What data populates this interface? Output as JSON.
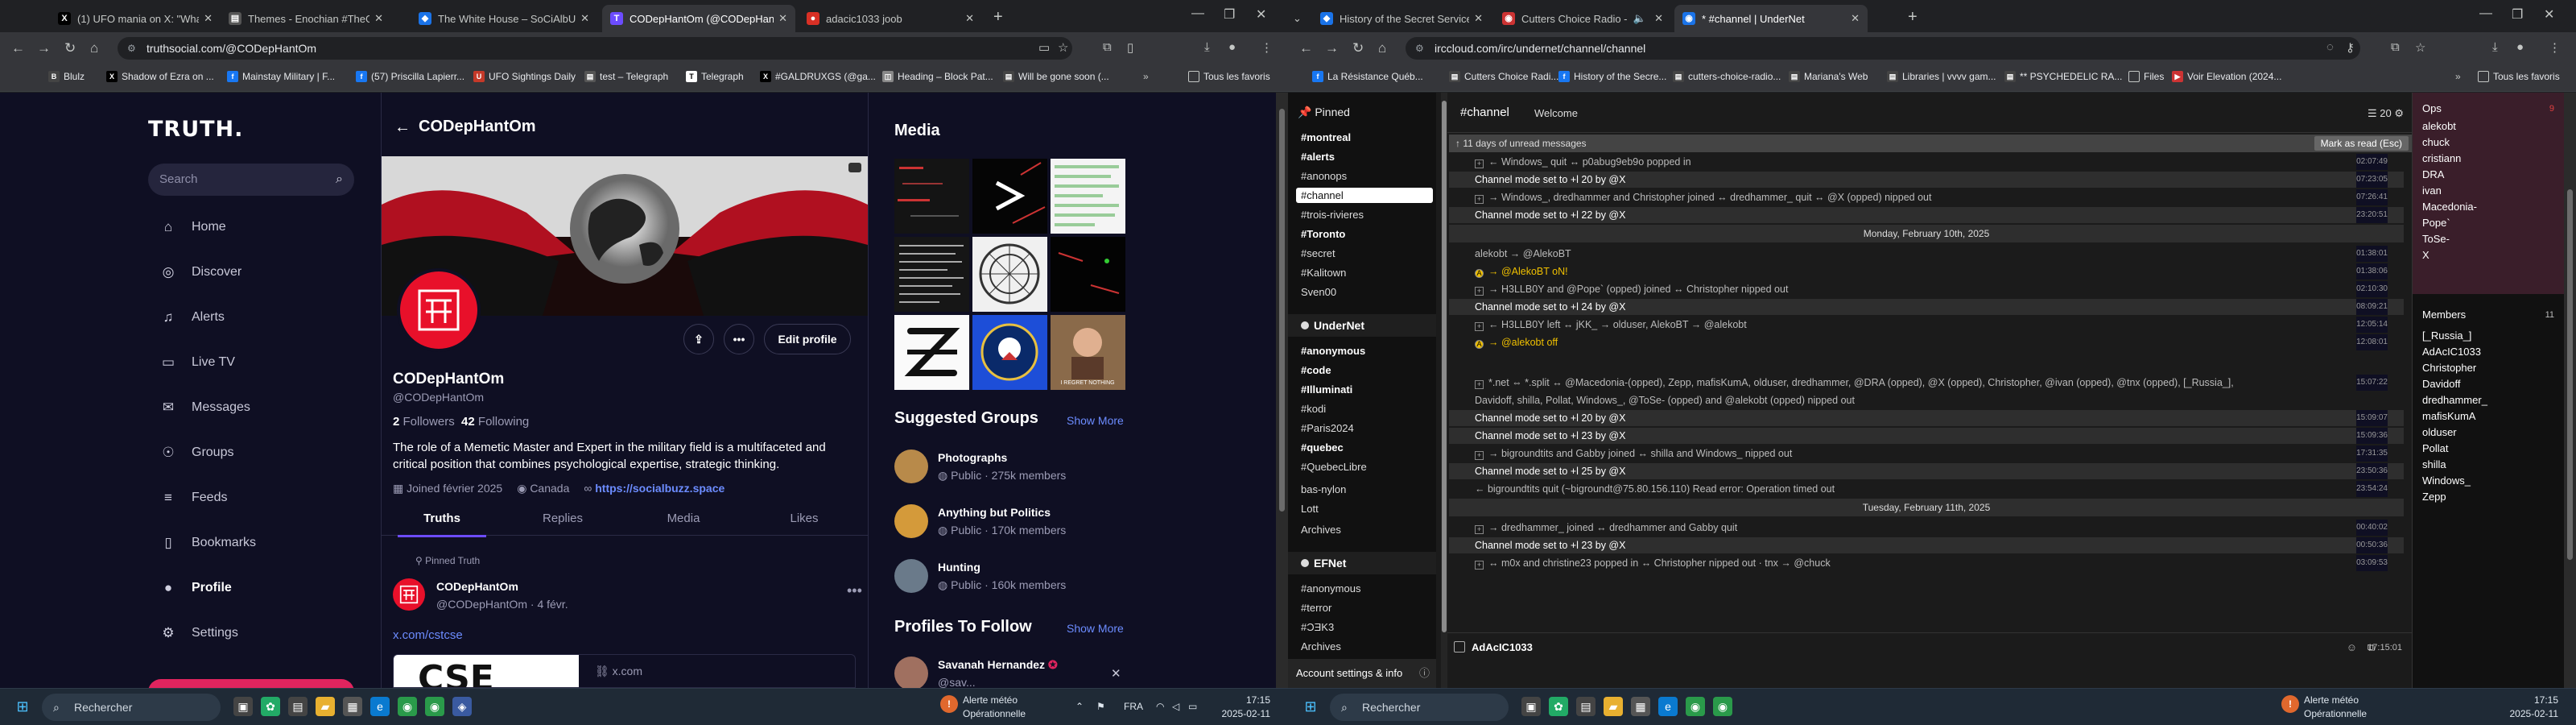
{
  "left": {
    "tabs": [
      {
        "title": "(1) UFO mania on X: \"What is th",
        "icon": "x-icon",
        "active": false
      },
      {
        "title": "Themes - Enochian #TheGame",
        "icon": "themes-icon",
        "active": false
      },
      {
        "title": "The White House – SoCiAlbUzz",
        "icon": "whitehouse-icon",
        "active": false
      },
      {
        "title": "CODepHantOm (@CODepHant",
        "icon": "truth-icon",
        "active": true
      },
      {
        "title": "adacic1033 joob",
        "icon": "joob-icon",
        "active": false
      }
    ],
    "url": "truthsocial.com/@CODepHantOm",
    "bookmarks": [
      "Blulz",
      "Shadow of Ezra on ...",
      "Mainstay Military | F...",
      "(57) Priscilla Lapierr...",
      "UFO Sightings Daily",
      "test – Telegraph",
      "Telegraph",
      "#GALDRUXGS (@ga...",
      "Heading – Block Pat...",
      "Will be gone soon (..."
    ],
    "bookmarks_folder": "Tous les favoris",
    "sidebar": {
      "logo": "TRUTH.",
      "search_placeholder": "Search",
      "nav": [
        "Home",
        "Discover",
        "Alerts",
        "Live TV",
        "Messages",
        "Groups",
        "Feeds",
        "Bookmarks",
        "Profile",
        "Settings"
      ],
      "active_nav": "Profile"
    },
    "profile": {
      "header": "CODepHantOm",
      "name": "CODepHantOm",
      "handle": "@CODepHantOm",
      "followers_count": "2",
      "followers_label": "Followers",
      "following_count": "42",
      "following_label": "Following",
      "bio": "The role of a Memetic Master and Expert in the military field is a multifaceted and critical position that combines psychological expertise, strategic thinking.",
      "joined": "Joined février 2025",
      "location": "Canada",
      "website": "https://socialbuzz.space",
      "edit_button": "Edit profile",
      "tabs": [
        "Truths",
        "Replies",
        "Media",
        "Likes"
      ],
      "active_tab": "Truths"
    },
    "post": {
      "pinned_label": "Pinned Truth",
      "author": "CODepHantOm",
      "meta": "@CODepHantOm · 4 févr.",
      "link": "x.com/cstcse",
      "card_domain": "x.com",
      "card_image_text": "CSE"
    },
    "right": {
      "media_title": "Media",
      "media_caption": "I REGRET NOTHING",
      "groups_title": "Suggested Groups",
      "show_more": "Show More",
      "groups": [
        {
          "name": "Photographs",
          "meta": "Public · 275k members"
        },
        {
          "name": "Anything but Politics",
          "meta": "Public · 170k members"
        },
        {
          "name": "Hunting",
          "meta": "Public · 160k members"
        }
      ],
      "follow_title": "Profiles To Follow",
      "follow_name": "Savanah Hernandez",
      "follow_handle": "@sav..."
    }
  },
  "right": {
    "tabs": [
      {
        "title": "History of the Secret Service | F",
        "active": false
      },
      {
        "title": "Cutters Choice Radio - Ho",
        "active": false
      },
      {
        "title": "* #channel | UnderNet",
        "active": true
      }
    ],
    "url": "irccloud.com/irc/undernet/channel/channel",
    "bookmarks": [
      "La Résistance Québ...",
      "Cutters Choice Radi...",
      "History of the Secre...",
      "cutters-choice-radio...",
      "Mariana's Web",
      "Libraries | vvvv gam...",
      "** PSYCHEDELIC RA...",
      "Files",
      "Voir Elevation (2024..."
    ],
    "bookmarks_folder": "Tous les favoris",
    "irc": {
      "pinned_label": "Pinned",
      "pinned": [
        "#montreal",
        "#alerts",
        "#anonops",
        "#channel",
        "#trois-rivieres",
        "#Toronto",
        "#secret",
        "#Kalitown",
        "Sven00"
      ],
      "selected_channel": "#channel",
      "networks": [
        {
          "name": "UnderNet",
          "channels": [
            "#anonymous",
            "#code",
            "#Illuminati",
            "#kodi",
            "#Paris2024",
            "#quebec",
            "#QuebecLibre",
            "bas-nylon",
            "Lott",
            "Archives"
          ]
        },
        {
          "name": "EFNet",
          "channels": [
            "#anonymous",
            "#terror",
            "#ƆƎK3",
            "Archives"
          ]
        }
      ],
      "account_settings": "Account settings & info",
      "channel": "#channel",
      "topic": "Welcome",
      "user_count": "20",
      "unread_text": "11 days of unread messages",
      "mark_read": "Mark as read (Esc)",
      "log": [
        {
          "kind": "ex",
          "text": "← Windows_ quit  ↔ p0abug9eb9o popped in",
          "time": "02:07:49"
        },
        {
          "kind": "mode",
          "text": "Channel mode set to +l 20 by @X",
          "time": "07:23:05"
        },
        {
          "kind": "ex",
          "text": "→ Windows_, dredhammer and Christopher joined  ↔ dredhammer_ quit  ↔ @X (opped)  nipped out",
          "time": "07:26:41"
        },
        {
          "kind": "mode",
          "text": "Channel mode set to +l 22 by @X",
          "time": "23:20:51"
        },
        {
          "kind": "date",
          "text": "Monday, February 10th, 2025"
        },
        {
          "kind": "plain",
          "text": "alekobt → @AlekoBT",
          "time": "01:38:01"
        },
        {
          "kind": "bot",
          "text": "→ @AlekoBT oN!",
          "time": "01:38:06"
        },
        {
          "kind": "ex",
          "text": "→ H3LLB0Y and @Pope` (opped) joined  ↔ Christopher nipped out",
          "time": "02:10:30"
        },
        {
          "kind": "mode",
          "text": "Channel mode set to +l 24 by @X",
          "time": "08:09:21"
        },
        {
          "kind": "ex",
          "text": "← H3LLB0Y left  ↔ jKK_ → olduser, AlekoBT → @alekobt",
          "time": "12:05:14"
        },
        {
          "kind": "bot",
          "text": "→ @alekobt off",
          "time": "12:08:01"
        },
        {
          "kind": "gap"
        },
        {
          "kind": "ex",
          "text": "*.net ⇔ *.split  ↔ @Macedonia-(opped), Zepp, mafisKumA, olduser, dredhammer, @DRA (opped), @X (opped), Christopher, @ivan (opped), @tnx (opped), [_Russia_],",
          "time": "15:07:22"
        },
        {
          "kind": "cont",
          "text": "Davidoff, shilla, Pollat, Windows_, @ToSe- (opped) and @alekobt (opped) nipped out"
        },
        {
          "kind": "mode",
          "text": "Channel mode set to +l 20 by @X",
          "time": "15:09:07"
        },
        {
          "kind": "mode",
          "text": "Channel mode set to +l 23 by @X",
          "time": "15:09:36"
        },
        {
          "kind": "ex",
          "text": "→ bigroundtits and Gabby joined  ↔ shilla and Windows_ nipped out",
          "time": "17:31:35"
        },
        {
          "kind": "mode",
          "text": "Channel mode set to +l 25 by @X",
          "time": "23:50:36"
        },
        {
          "kind": "plain",
          "text": "← bigroundtits quit (~bigroundt@75.80.156.110) Read error: Operation timed out",
          "time": "23:54:24"
        },
        {
          "kind": "date",
          "text": "Tuesday, February 11th, 2025"
        },
        {
          "kind": "ex",
          "text": "→ dredhammer_ joined  ↔ dredhammer and Gabby quit",
          "time": "00:40:02"
        },
        {
          "kind": "mode",
          "text": "Channel mode set to +l 23 by @X",
          "time": "00:50:36"
        },
        {
          "kind": "ex",
          "text": "↔ m0x and christine23 popped in  ↔ Christopher nipped out  · tnx → @chuck",
          "time": "03:09:53"
        }
      ],
      "input_nick": "AdAcIC1033",
      "input_time": "17:15:01",
      "ops_label": "Ops",
      "ops_count": "9",
      "ops": [
        "alekobt",
        "chuck",
        "cristiann",
        "DRA",
        "ivan",
        "Macedonia-",
        "Pope`",
        "ToSe-",
        "X"
      ],
      "members_label": "Members",
      "members_count": "11",
      "members": [
        "[_Russia_]",
        "AdAcIC1033",
        "Christopher",
        "Davidoff",
        "dredhammer_",
        "mafisKumA",
        "olduser",
        "Pollat",
        "shilla",
        "Windows_",
        "Zepp"
      ]
    }
  },
  "taskbar": {
    "search_label": "Rechercher",
    "weather_title": "Alerte météo",
    "weather_sub": "Opérationnelle",
    "lang": "FRA",
    "time": "17:15",
    "date": "2025-02-11"
  },
  "colors": {
    "truth_bg": "#0f0f23",
    "truth_accent": "#6c4cff",
    "truth_red": "#e8102a",
    "irc_bg": "#1b1b1b",
    "ops_bg": "#3a1e2a"
  }
}
